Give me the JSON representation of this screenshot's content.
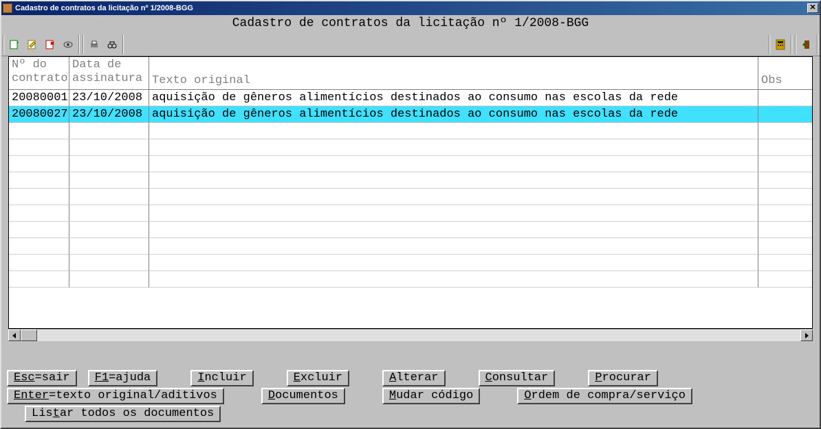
{
  "window": {
    "title": "Cadastro de contratos da licitação nº 1/2008-BGG"
  },
  "heading": "Cadastro de contratos da licitação nº 1/2008-BGG",
  "toolbar": {
    "icons": [
      "new",
      "edit",
      "delete",
      "view",
      "print",
      "find",
      "calculator",
      "exit"
    ]
  },
  "grid": {
    "headers": {
      "col0": "Nº do\ncontrato",
      "col1": "Data de\nassinatura",
      "col2": "Texto original",
      "col3": "Obs"
    },
    "rows": [
      {
        "num": "20080001",
        "data": "23/10/2008",
        "texto": "aquisição de gêneros alimentícios destinados ao consumo nas escolas da rede",
        "obs": "",
        "selected": false
      },
      {
        "num": "20080027",
        "data": "23/10/2008",
        "texto": "aquisição de gêneros alimentícios destinados ao consumo nas escolas da rede",
        "obs": "",
        "selected": true
      }
    ],
    "empty_rows": 10
  },
  "buttons": {
    "esc": {
      "k": "Esc",
      "r": "=sair"
    },
    "f1": {
      "k": "F1",
      "r": "=ajuda"
    },
    "incluir": {
      "pre": "",
      "k": "I",
      "r": "ncluir"
    },
    "excluir": {
      "pre": "",
      "k": "E",
      "r": "xcluir"
    },
    "alterar": {
      "pre": "",
      "k": "A",
      "r": "lterar"
    },
    "consultar": {
      "pre": "",
      "k": "C",
      "r": "onsultar"
    },
    "procurar": {
      "pre": "",
      "k": "P",
      "r": "rocurar"
    },
    "enter": {
      "k": "Enter",
      "r": "=texto original/aditivos"
    },
    "documentos": {
      "pre": "",
      "k": "D",
      "r": "ocumentos"
    },
    "mudar": {
      "pre": "",
      "k": "M",
      "r": "udar código"
    },
    "ordem": {
      "pre": "",
      "k": "O",
      "r": "rdem de compra/serviço"
    },
    "listar": {
      "pre": "Lis",
      "k": "t",
      "r": "ar todos os documentos"
    }
  }
}
